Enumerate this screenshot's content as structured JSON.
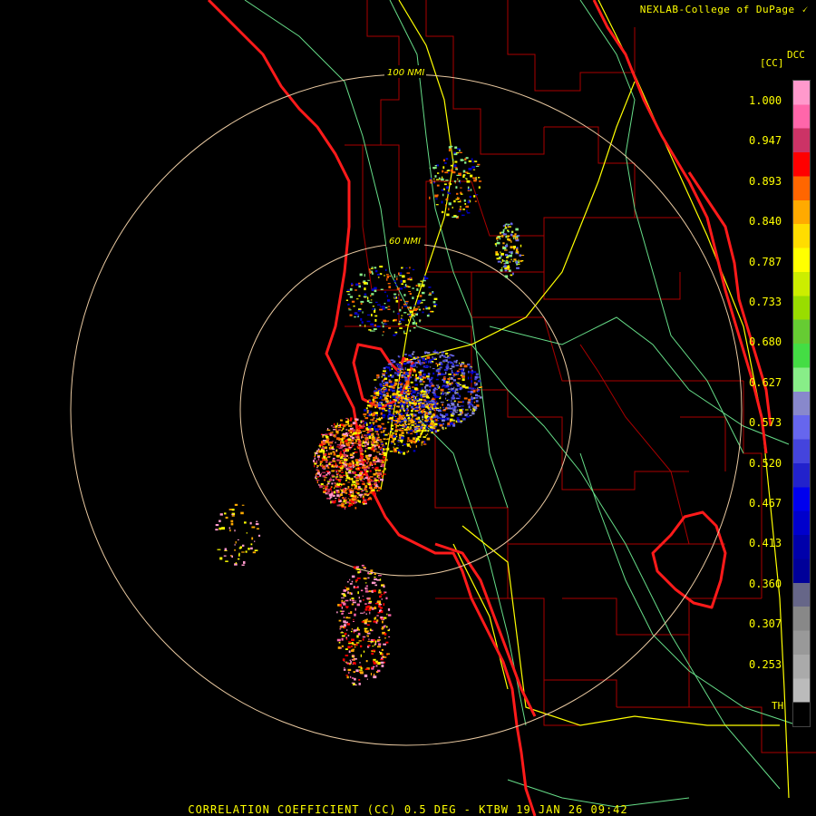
{
  "header": {
    "brand": "NEXLAB-College of DuPage",
    "logo_icon": "cod-logo-icon"
  },
  "legend": {
    "product": "DCC",
    "units": "[CC]",
    "ticks": [
      "1.000",
      "0.947",
      "0.893",
      "0.840",
      "0.787",
      "0.733",
      "0.680",
      "0.627",
      "0.573",
      "0.520",
      "0.467",
      "0.413",
      "0.360",
      "0.307",
      "0.253"
    ],
    "threshold_label": "TH",
    "colors": [
      "#ff99cc",
      "#ff66aa",
      "#cc3366",
      "#ff0000",
      "#ff6600",
      "#ffaa00",
      "#ffdd00",
      "#ffff00",
      "#ccee00",
      "#99dd00",
      "#66cc33",
      "#44dd44",
      "#88ee88",
      "#8888cc",
      "#6666ee",
      "#4444dd",
      "#2222cc",
      "#0000ee",
      "#0000cc",
      "#0000aa",
      "#000099",
      "#666688",
      "#888888",
      "#999999",
      "#aaaaaa",
      "#bbbbbb",
      "#000000"
    ]
  },
  "rings": {
    "inner_label": "60 NMI",
    "outer_label": "100 NMI"
  },
  "footer": {
    "caption": "CORRELATION COEFFICIENT (CC) 0.5 DEG - KTBW 19 JAN 26 09:42"
  },
  "colors": {
    "coast": "#ff1a1a",
    "county": "#aa0000",
    "highway_major": "#ffff00",
    "highway_minor": "#66dd88",
    "ring": "#e8c8a0"
  }
}
